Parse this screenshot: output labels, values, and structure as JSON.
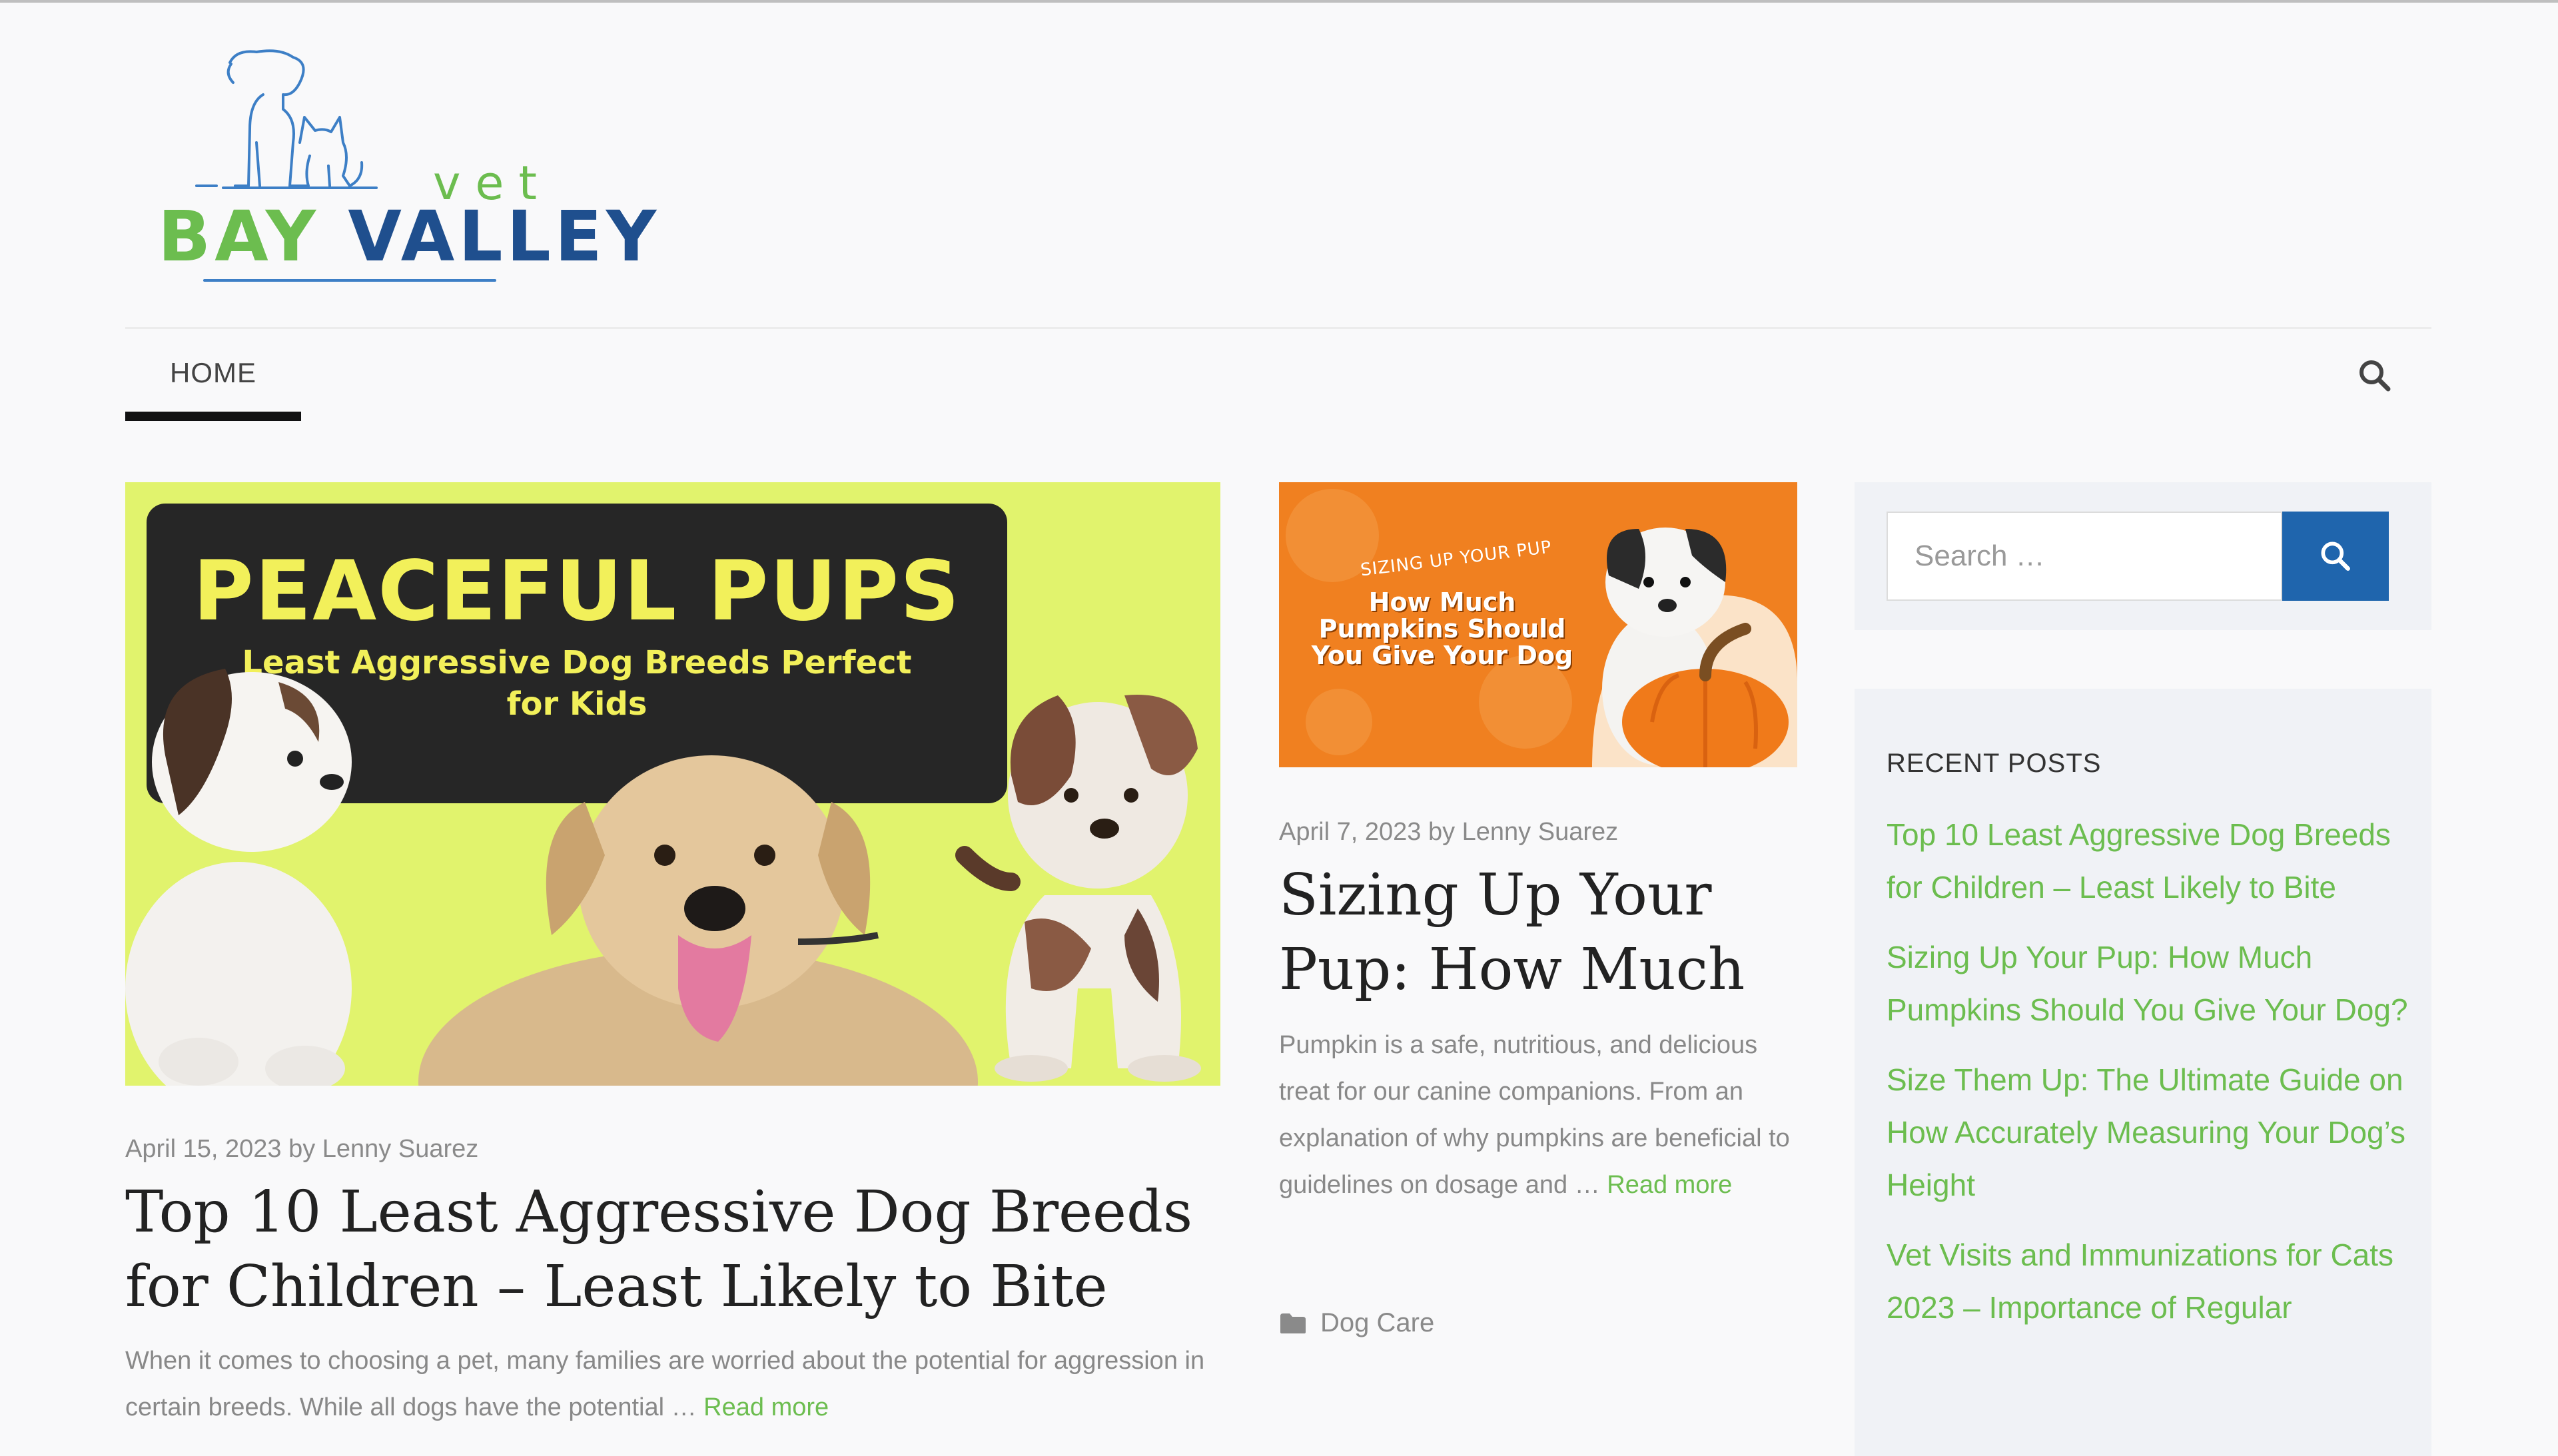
{
  "site": {
    "logo_small": "vet",
    "logo_word1": "BAY",
    "logo_word2": "VALLEY"
  },
  "colors": {
    "accent_green": "#6cbd4f",
    "brand_blue": "#1f4f8e",
    "button_blue": "#1f65ad"
  },
  "nav": {
    "home_label": "HOME",
    "search_icon": "search-icon"
  },
  "posts": [
    {
      "image_title": "PEACEFUL PUPS",
      "image_subtitle": "Least Aggressive Dog Breeds Perfect for Kids",
      "date": "April 15, 2023",
      "by": "by",
      "author": "Lenny Suarez",
      "title": "Top 10 Least Aggressive Dog Breeds for Children – Least Likely to Bite",
      "excerpt": "When it comes to choosing a pet, many families are worried about the potential for aggression in certain breeds. While all dogs have the potential …",
      "read_more": "Read more"
    },
    {
      "image_kicker": "SIZING UP YOUR PUP",
      "image_heading": "How Much Pumpkins Should You Give Your Dog",
      "date": "April 7, 2023",
      "by": "by",
      "author": "Lenny Suarez",
      "title": "Sizing Up Your Pup: How Much",
      "excerpt": "Pumpkin is a safe, nutritious, and delicious treat for our canine companions. From an explanation of why pumpkins are beneficial to guidelines on dosage and …",
      "read_more": "Read more",
      "category": "Dog Care",
      "category_icon": "folder-icon"
    }
  ],
  "sidebar": {
    "search_placeholder": "Search …",
    "recent_heading": "RECENT POSTS",
    "recent_posts": [
      "Top 10 Least Aggressive Dog Breeds for Children – Least Likely to Bite",
      "Sizing Up Your Pup: How Much Pumpkins Should You Give Your Dog?",
      "Size Them Up: The Ultimate Guide on How Accurately Measuring Your Dog’s Height",
      "Vet Visits and Immunizations for Cats 2023 – Importance of Regular"
    ]
  }
}
